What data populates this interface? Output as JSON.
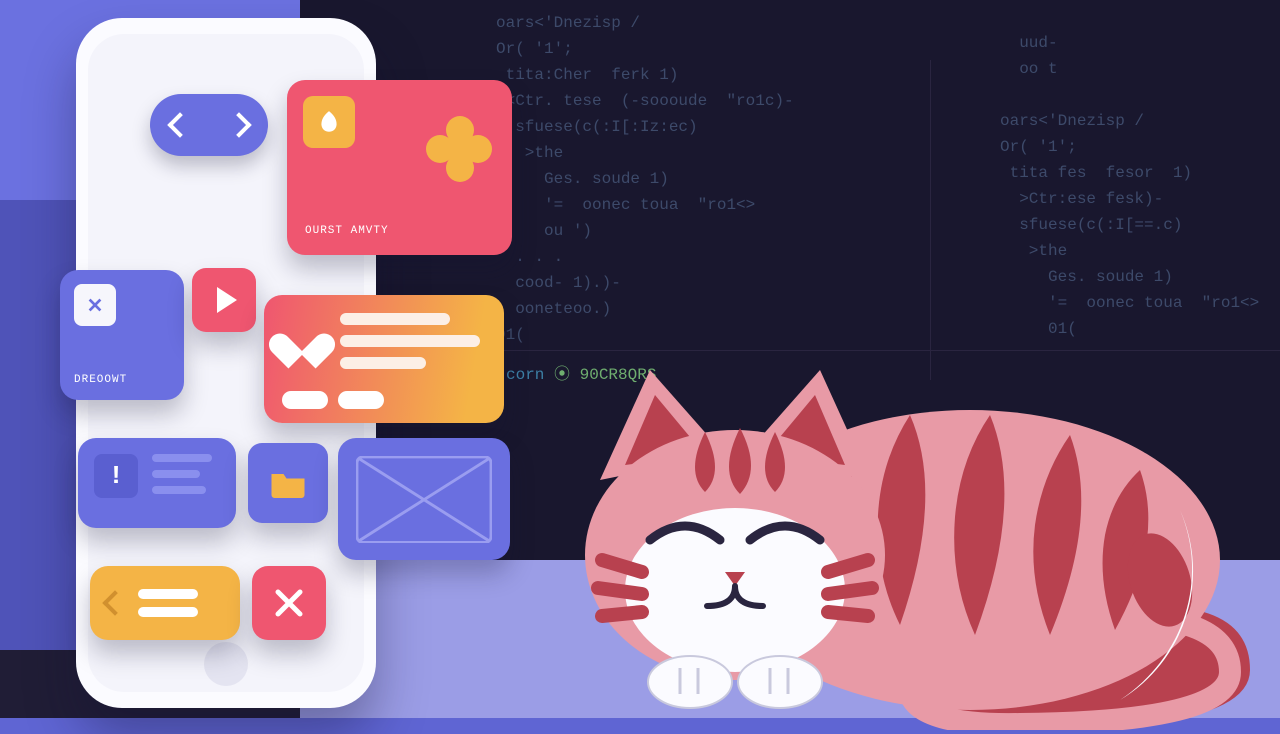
{
  "cards": {
    "red": {
      "label": "OURST AMVTY"
    },
    "purple": {
      "label": "DREOOWT"
    }
  },
  "code_left": "oars<'Dnezisp /\nOr( '1';\n tita:Cher  ferk 1)\n <Ctr. tese  (-soooude  \"ro1c)-\n  sfuese(c(:I[:Iz:ec)\n   >the\n     Ges. soude 1)\n     '=  oonec toua  \"ro1<>\n     ou ')\n  . . .\n  cood- 1).)-\n  ooneteoo.)\n01(",
  "code_right": "  uud-\n  oo t\n\noars<'Dnezisp /\nOr( '1';\n tita fes  fesor  1)\n  >Ctr:ese fesk)-\n  sfuese(c(:I[==.c)\n   >the\n     Ges. soude 1)\n     '=  oonec toua  \"ro1<>\n     01(",
  "code_footer_a": "corn",
  "code_footer_b": "90CR8QRS"
}
